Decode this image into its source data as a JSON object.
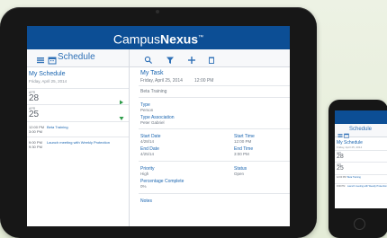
{
  "colors": {
    "brand_blue": "#0c4e95",
    "link_blue": "#1a65b0",
    "accent_green": "#2e9c4a"
  },
  "app": {
    "brand_light": "Campus",
    "brand_bold": "Nexus",
    "brand_mark": "™"
  },
  "toolbar": {
    "title": "Schedule",
    "icons": [
      "menu-icon",
      "calendar-icon",
      "search-icon",
      "filter-icon",
      "add-icon",
      "delete-icon"
    ]
  },
  "schedule": {
    "heading": "My Schedule",
    "date": "Friday, April 25, 2014",
    "days": [
      {
        "month": "APR",
        "day": "28",
        "arrow": "right"
      },
      {
        "month": "APR",
        "day": "25",
        "arrow": "down"
      }
    ],
    "events": [
      {
        "start": "12:00 PM",
        "end": "3:00 PM",
        "title": "Beta Training"
      },
      {
        "start": "9:00 PM",
        "end": "9:30 PM",
        "title": "Launch meeting with Weekly Protection"
      }
    ]
  },
  "task": {
    "title": "My Task",
    "date": "Friday, April 25, 2014",
    "time": "12:00 PM",
    "description": "Beta Training",
    "type_label": "Type",
    "type_value": "Person",
    "type_assoc_label": "Type Association",
    "type_assoc_value": "Peter Gabriel",
    "start_date_label": "Start Date",
    "start_date_value": "4/28/14",
    "start_time_label": "Start Time",
    "start_time_value": "12:00 PM",
    "end_date_label": "End Date",
    "end_date_value": "4/25/14",
    "end_time_label": "End Time",
    "end_time_value": "3:00 PM",
    "priority_label": "Priority",
    "priority_value": "High",
    "status_label": "Status",
    "status_value": "Open",
    "percent_label": "Percentage Complete",
    "percent_value": "0%",
    "notes_label": "Notes"
  },
  "iphone": {
    "title": "Schedule",
    "heading": "My Schedule",
    "date": "Friday, April 25, 2014",
    "days": [
      {
        "month": "APR",
        "day": "28"
      },
      {
        "month": "APR",
        "day": "25"
      }
    ],
    "events": [
      {
        "time": "12:00 PM",
        "title": "Beta Training"
      },
      {
        "time": "9:00 PM",
        "title": "Launch meeting with Weekly Protection"
      }
    ]
  }
}
